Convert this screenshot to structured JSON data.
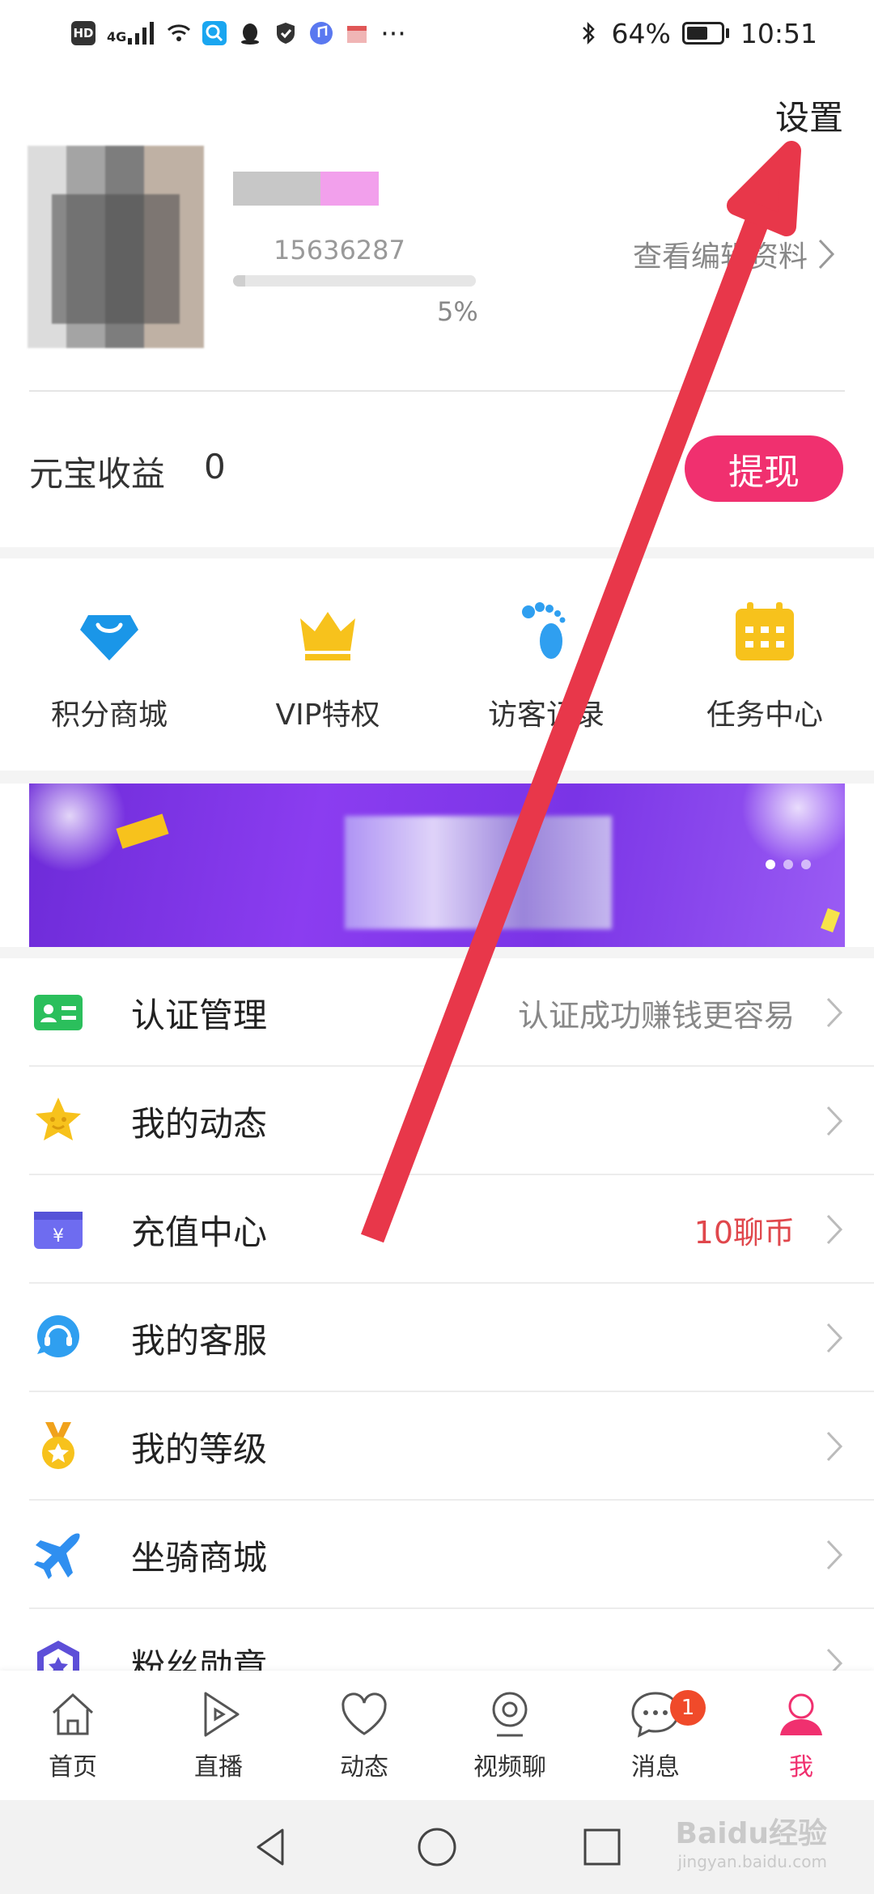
{
  "status_bar": {
    "network_badge": "HD",
    "signal_label": "4G",
    "battery_percent": "64%",
    "battery_level": 0.64,
    "time": "10:51",
    "more": "···"
  },
  "header": {
    "settings_label": "设置",
    "user_id_partial": "15636287",
    "profile_progress": "5%",
    "profile_progress_value": 0.05,
    "edit_profile_label": "查看编辑资料"
  },
  "earnings": {
    "label": "元宝收益",
    "value": "0",
    "withdraw_label": "提现"
  },
  "quick_entries": [
    {
      "label": "积分商城",
      "icon": "shopping-bag-icon"
    },
    {
      "label": "VIP特权",
      "icon": "crown-icon"
    },
    {
      "label": "访客记录",
      "icon": "footprint-icon"
    },
    {
      "label": "任务中心",
      "icon": "calendar-icon"
    }
  ],
  "menu": [
    {
      "label": "认证管理",
      "hint": "认证成功赚钱更容易",
      "icon": "id-card-icon"
    },
    {
      "label": "我的动态",
      "hint": "",
      "icon": "star-icon"
    },
    {
      "label": "充值中心",
      "hint": "10聊币",
      "icon": "wallet-icon"
    },
    {
      "label": "我的客服",
      "hint": "",
      "icon": "headset-icon"
    },
    {
      "label": "我的等级",
      "hint": "",
      "icon": "medal-icon"
    },
    {
      "label": "坐骑商城",
      "hint": "",
      "icon": "plane-icon"
    },
    {
      "label": "粉丝勋章",
      "hint": "",
      "icon": "badge-icon"
    }
  ],
  "tabbar": [
    {
      "label": "首页",
      "icon": "home-icon"
    },
    {
      "label": "直播",
      "icon": "live-play-icon"
    },
    {
      "label": "动态",
      "icon": "heart-icon"
    },
    {
      "label": "视频聊",
      "icon": "video-chat-icon"
    },
    {
      "label": "消息",
      "icon": "message-icon",
      "badge": "1"
    },
    {
      "label": "我",
      "icon": "profile-icon"
    }
  ],
  "watermark": {
    "brand": "Baidu经验",
    "site": "jingyan.baidu.com"
  },
  "colors": {
    "accent": "#f0306f",
    "hint_red": "#e0474c",
    "annotation_arrow": "#e8374a"
  }
}
